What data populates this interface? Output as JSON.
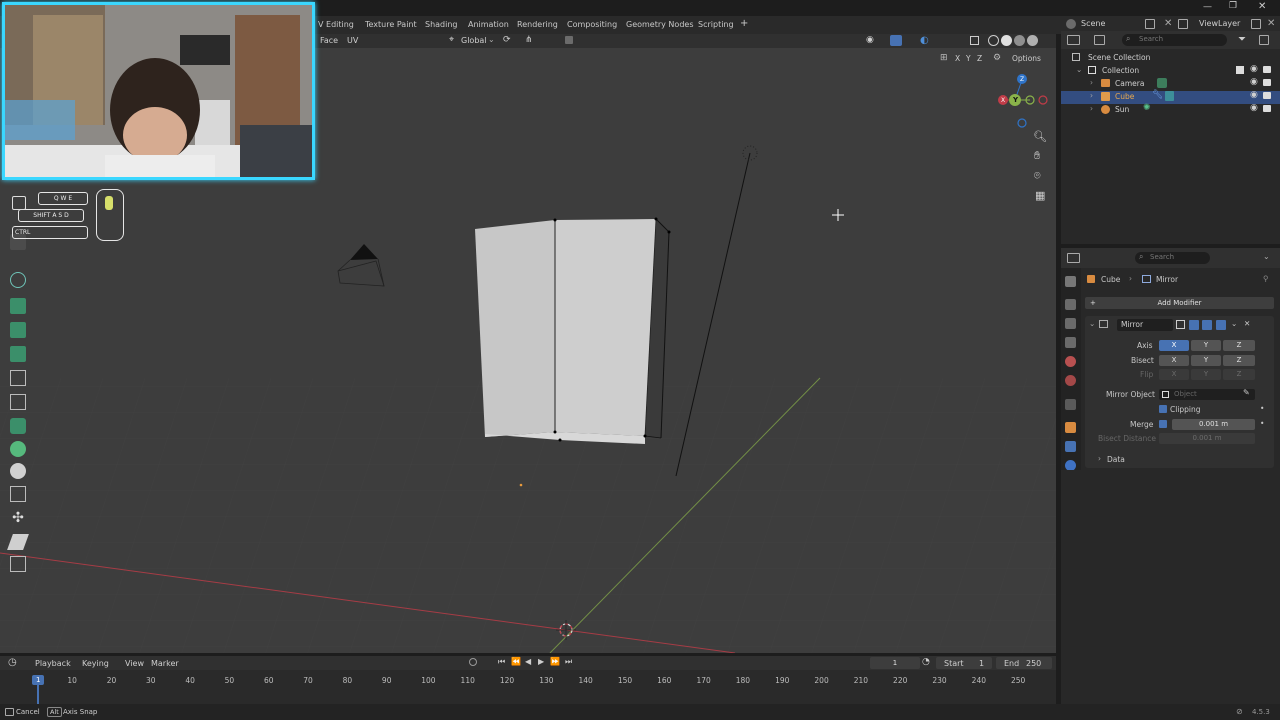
{
  "workspace_tabs": [
    "V Editing",
    "Texture Paint",
    "Shading",
    "Animation",
    "Rendering",
    "Compositing",
    "Geometry Nodes",
    "Scripting",
    "+"
  ],
  "scene": {
    "label": "Scene",
    "view_layer": "ViewLayer"
  },
  "viewport_header": {
    "menus": [
      "Face",
      "UV"
    ],
    "orientation": "Global",
    "options": "Options",
    "axis_toggles": [
      "X",
      "Y",
      "Z"
    ]
  },
  "keys": {
    "row1": [
      "Q",
      "W",
      "E"
    ],
    "row2": [
      "A",
      "S",
      "D"
    ],
    "shift": "SHIFT",
    "ctrl": "CTRL"
  },
  "gizmo": {
    "x": "X",
    "y": "Y",
    "z": "Z"
  },
  "outliner": {
    "search_placeholder": "Search",
    "scene_collection": "Scene Collection",
    "collection": "Collection",
    "items": [
      "Camera",
      "Cube",
      "Sun"
    ]
  },
  "properties": {
    "search_placeholder": "Search",
    "breadcrumb_object": "Cube",
    "breadcrumb_modifier": "Mirror",
    "add_modifier": "Add Modifier",
    "modifier_name": "Mirror",
    "axis_label": "Axis",
    "bisect_label": "Bisect",
    "flip_label": "Flip",
    "xyz": [
      "X",
      "Y",
      "Z"
    ],
    "mirror_object_label": "Mirror Object",
    "mirror_object_placeholder": "Object",
    "clipping_label": "Clipping",
    "merge_label": "Merge",
    "merge_value": "0.001 m",
    "bisect_distance_label": "Bisect Distance",
    "bisect_distance_value": "0.001 m",
    "data_label": "Data"
  },
  "timeline": {
    "menus": [
      "Playback",
      "Keying",
      "View",
      "Marker"
    ],
    "current_frame": "1",
    "start_label": "Start",
    "start_value": "1",
    "end_label": "End",
    "end_value": "250",
    "ticks": [
      "1",
      "10",
      "20",
      "30",
      "40",
      "50",
      "60",
      "70",
      "80",
      "90",
      "100",
      "110",
      "120",
      "130",
      "140",
      "150",
      "160",
      "170",
      "180",
      "190",
      "200",
      "210",
      "220",
      "230",
      "240",
      "250"
    ]
  },
  "statusbar": {
    "cancel": "Cancel",
    "alt": "Alt",
    "axis_snap": "Axis Snap",
    "version": "4.5.3"
  },
  "colors": {
    "accent": "#4772b3",
    "x_axis": "#c13c48",
    "y_axis": "#8ab34a",
    "z_axis": "#2f74c9",
    "webcam_border": "#3ad7ff"
  }
}
